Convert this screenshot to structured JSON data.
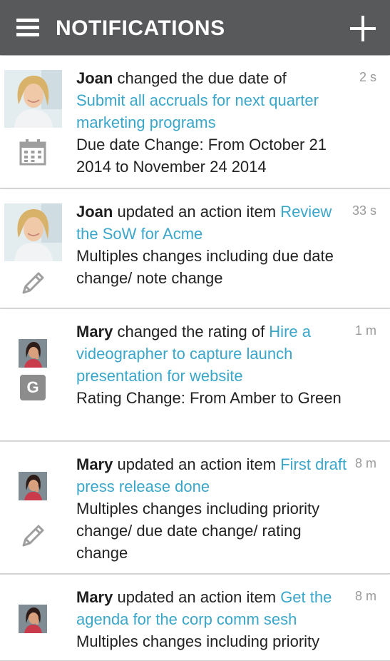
{
  "header": {
    "title": "NOTIFICATIONS",
    "menu_icon": "hamburger-menu-icon",
    "add_icon": "plus-icon"
  },
  "notifications": [
    {
      "actor": "Joan",
      "action": " changed the due date of ",
      "link": "Submit all accruals for next quarter marketing programs",
      "details": "Due date Change: From October 21 2014 to November 24 2014",
      "time": "2 s",
      "type_icon": "calendar-icon"
    },
    {
      "actor": "Joan",
      "action": " updated an action item ",
      "link": "Review the SoW for Acme",
      "details": "Multiples changes including due date change/ note change",
      "time": "33 s",
      "type_icon": "pencil-icon"
    },
    {
      "actor": "Mary",
      "action": " changed the rating of ",
      "link": "Hire a videographer to capture launch presentation for website",
      "details": "Rating Change: From Amber to Green",
      "time": "1 m",
      "type_icon": "rating-green-badge-icon",
      "badge_letter": "G"
    },
    {
      "actor": "Mary",
      "action": " updated an action item ",
      "link": "First draft press release done",
      "details": "Multiples changes including priority change/ due date change/ rating change",
      "time": "8 m",
      "type_icon": "pencil-icon"
    },
    {
      "actor": "Mary",
      "action": " updated an action item ",
      "link": "Get the agenda for the corp comm sesh",
      "details": "Multiples changes including priority",
      "time": "8 m",
      "type_icon": "pencil-icon"
    }
  ],
  "colors": {
    "appbar": "#58595b",
    "link": "#3aa6c9",
    "time": "#9a9a9a",
    "icon": "#9e9e9e"
  }
}
